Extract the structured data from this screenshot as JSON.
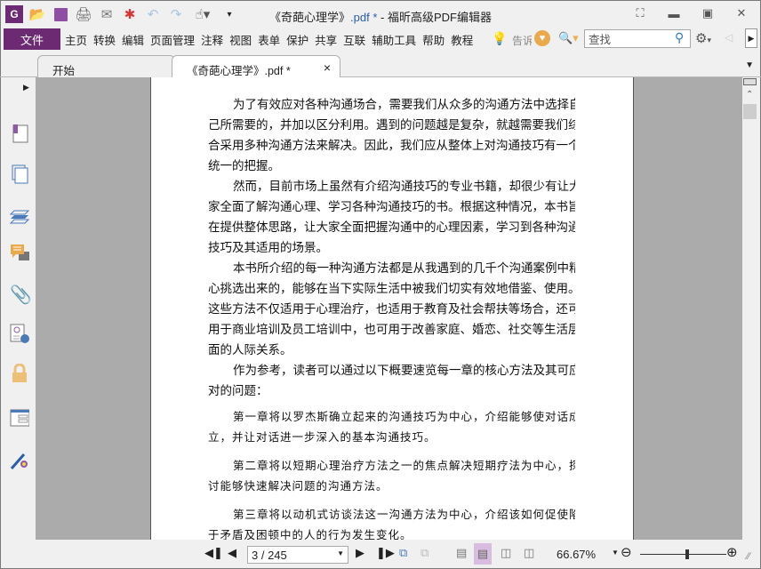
{
  "app": {
    "title_prefix": "《奇葩心理学》",
    "title_ext": ".pdf *",
    "title_suffix": " - 福昕高级PDF编辑器"
  },
  "quick_access": [
    "app-logo-icon",
    "open-folder-icon",
    "save-icon",
    "print-icon",
    "email-icon",
    "new-icon",
    "undo-icon",
    "redo-icon",
    "hand-tool-icon",
    "customize-dropdown-icon"
  ],
  "window_controls": [
    "fullscreen-icon",
    "minimize-icon",
    "restore-icon",
    "close-icon"
  ],
  "menu": {
    "file": "文件",
    "items": [
      "主页",
      "转换",
      "编辑",
      "页面管理",
      "注释",
      "视图",
      "表单",
      "保护",
      "共享",
      "互联",
      "辅助工具",
      "帮助",
      "教程"
    ],
    "tell_me": "告诉"
  },
  "search": {
    "placeholder": "查找"
  },
  "tabs": [
    {
      "label": "开始"
    },
    {
      "label": "《奇葩心理学》.pdf *",
      "close": "×"
    }
  ],
  "left_panel": [
    "bookmarks-icon",
    "pages-icon",
    "layers-icon",
    "comments-icon",
    "attachments-icon",
    "signatures-icon",
    "security-icon",
    "form-fields-icon",
    "certify-icon"
  ],
  "document": {
    "paragraphs": [
      {
        "small": false,
        "lines": [
          "为了有效应对各种沟通场合，需要我们从众多的沟通方法中选择自",
          "己所需要的，并加以区分利用。遇到的问题越是复杂，就越需要我们综",
          "合采用多种沟通方法来解决。因此，我们应从整体上对沟通技巧有一个",
          "统一的把握。"
        ]
      },
      {
        "small": false,
        "lines": [
          "然而，目前市场上虽然有介绍沟通技巧的专业书籍，却很少有让大",
          "家全面了解沟通心理、学习各种沟通技巧的书。根据这种情况，本书旨",
          "在提供整体思路，让大家全面把握沟通中的心理因素，学习到各种沟通",
          "技巧及其适用的场景。"
        ]
      },
      {
        "small": false,
        "lines": [
          "本书所介绍的每一种沟通方法都是从我遇到的几千个沟通案例中精",
          "心挑选出来的，能够在当下实际生活中被我们切实有效地借鉴、使用。",
          "这些方法不仅适用于心理治疗，也适用于教育及社会帮扶等场合，还可",
          "用于商业培训及员工培训中，也可用于改善家庭、婚恋、社交等生活层",
          "面的人际关系。"
        ]
      },
      {
        "small": false,
        "lines": [
          "作为参考，读者可以通过以下概要速览每一章的核心方法及其可应",
          "对的问题："
        ]
      },
      {
        "small": true,
        "lines": [
          "第一章将以罗杰斯确立起来的沟通技巧为中心，介绍能够使对话成",
          "立，并让对话进一步深入的基本沟通技巧。"
        ]
      },
      {
        "small": true,
        "lines": [
          "第二章将以短期心理治疗方法之一的焦点解决短期疗法为中心，探",
          "讨能够快速解决问题的沟通方法。"
        ]
      },
      {
        "small": true,
        "lines": [
          "第三章将以动机式访谈法这一沟通方法为中心，介绍该如何促使陷",
          "于矛盾及困顿中的人的行为发生变化。"
        ]
      }
    ]
  },
  "status": {
    "page": "3 / 245",
    "zoom": "66.67%",
    "zoom_fraction": 0.55
  },
  "colors": {
    "accent": "#6b2a72",
    "page_bg": "#ababab"
  }
}
